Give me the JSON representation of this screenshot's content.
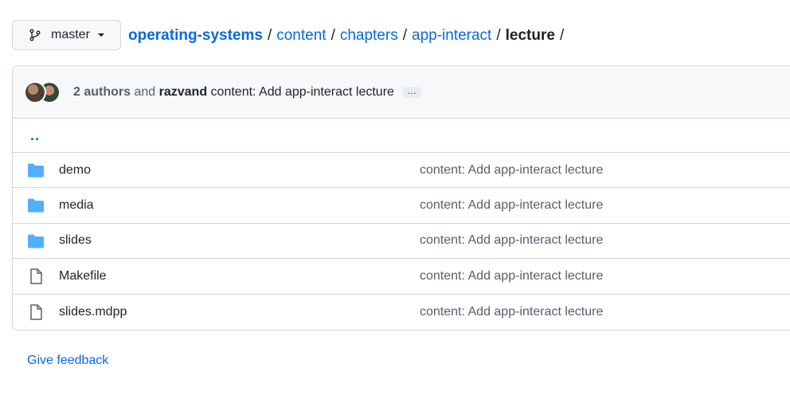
{
  "branch": {
    "label": "master",
    "icon": "git-branch-icon",
    "caret": "chevron-down-icon"
  },
  "breadcrumb": {
    "repo": "operating-systems",
    "parts": [
      "content",
      "chapters",
      "app-interact"
    ],
    "current": "lecture",
    "separator": "/"
  },
  "commit": {
    "authors": "2 authors",
    "and": "and",
    "author_name": "razvand",
    "message": "content: Add app-interact lecture",
    "ellipsis": "…"
  },
  "parent_link": "..",
  "files": [
    {
      "name": "demo",
      "type": "folder",
      "commit": "content: Add app-interact lecture"
    },
    {
      "name": "media",
      "type": "folder",
      "commit": "content: Add app-interact lecture"
    },
    {
      "name": "slides",
      "type": "folder",
      "commit": "content: Add app-interact lecture"
    },
    {
      "name": "Makefile",
      "type": "file",
      "commit": "content: Add app-interact lecture"
    },
    {
      "name": "slides.mdpp",
      "type": "file",
      "commit": "content: Add app-interact lecture"
    }
  ],
  "feedback": "Give feedback",
  "colors": {
    "link": "#0969da",
    "folder": "#54aeff",
    "border": "#d0d7de",
    "muted": "#57606a"
  }
}
